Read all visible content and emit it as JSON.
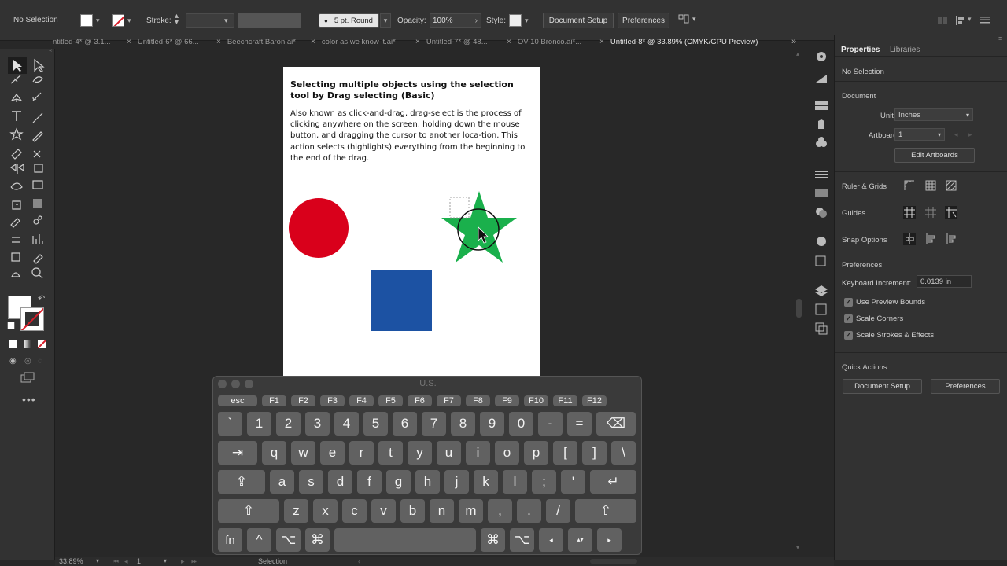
{
  "control_bar": {
    "selection_label": "No Selection",
    "stroke_label": "Stroke:",
    "brush_label": "5 pt. Round",
    "opacity_label": "Opacity:",
    "opacity_value": "100%",
    "style_label": "Style:",
    "document_setup": "Document Setup",
    "preferences": "Preferences"
  },
  "tabs": [
    {
      "label": "ntitled-4* @ 3.1..."
    },
    {
      "label": "Untitled-6* @ 66..."
    },
    {
      "label": "Beechcraft Baron.ai*"
    },
    {
      "label": "color as we know it.ai*"
    },
    {
      "label": "Untitled-7* @ 48..."
    },
    {
      "label": "OV-10 Bronco.ai*..."
    },
    {
      "label": "Untitled-8* @ 33.89% (CMYK/GPU Preview)"
    }
  ],
  "artboard": {
    "heading": "Selecting multiple objects using the selection tool by Drag selecting (Basic)",
    "body": "Also known as click-and-drag, drag-select is the process of clicking anywhere on the screen, holding down the mouse button, and dragging the cursor to another loca-tion. This action selects (highlights) everything from the beginning to the end of the drag.",
    "colors": {
      "circle": "#d9001b",
      "star": "#1ab04c",
      "square": "#1c52a3"
    }
  },
  "properties": {
    "tab_properties": "Properties",
    "tab_libraries": "Libraries",
    "no_selection": "No Selection",
    "document": "Document",
    "units_label": "Units:",
    "units_value": "Inches",
    "artboard_label": "Artboard:",
    "artboard_value": "1",
    "edit_artboards": "Edit Artboards",
    "ruler_grids": "Ruler & Grids",
    "guides": "Guides",
    "snap_options": "Snap Options",
    "preferences_head": "Preferences",
    "keyboard_increment_label": "Keyboard Increment:",
    "keyboard_increment_value": "0.0139 in",
    "use_preview_bounds": "Use Preview Bounds",
    "scale_corners": "Scale Corners",
    "scale_strokes": "Scale Strokes & Effects",
    "quick_actions": "Quick Actions",
    "document_setup": "Document Setup",
    "preferences": "Preferences"
  },
  "keyboard": {
    "title": "U.S.",
    "fn_row": [
      "esc",
      "F1",
      "F2",
      "F3",
      "F4",
      "F5",
      "F6",
      "F7",
      "F8",
      "F9",
      "F10",
      "F11",
      "F12"
    ],
    "row1": [
      "`",
      "1",
      "2",
      "3",
      "4",
      "5",
      "6",
      "7",
      "8",
      "9",
      "0",
      "-",
      "=",
      "⌫"
    ],
    "row2": [
      "⇥",
      "q",
      "w",
      "e",
      "r",
      "t",
      "y",
      "u",
      "i",
      "o",
      "p",
      "[",
      "]",
      "\\"
    ],
    "row3": [
      "⇪",
      "a",
      "s",
      "d",
      "f",
      "g",
      "h",
      "j",
      "k",
      "l",
      ";",
      "'",
      "↵"
    ],
    "row4": [
      "⇧",
      "z",
      "x",
      "c",
      "v",
      "b",
      "n",
      "m",
      ",",
      ".",
      "/",
      "⇧"
    ],
    "row5": [
      "fn",
      "^",
      "⌥",
      "⌘",
      "",
      "⌘",
      "⌥",
      "◂",
      "▴▾",
      "▸"
    ]
  },
  "status_bar": {
    "zoom": "33.89%",
    "artboard_num": "1",
    "tool": "Selection"
  }
}
